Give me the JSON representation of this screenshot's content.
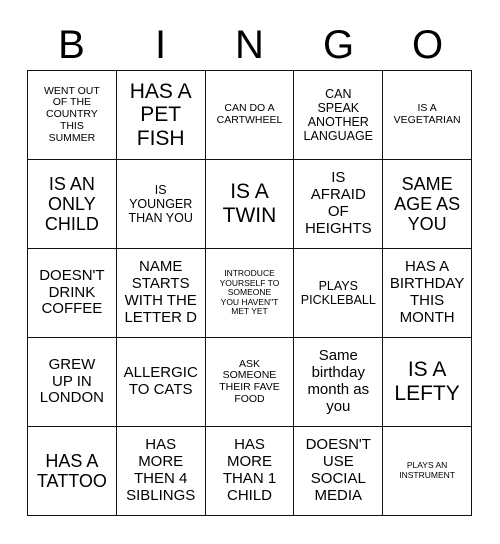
{
  "header": {
    "letters": [
      "B",
      "I",
      "N",
      "G",
      "O"
    ]
  },
  "grid": {
    "rows": 5,
    "columns": 5,
    "cells": [
      {
        "text": "WENT OUT\nOF THE\nCOUNTRY\nTHIS\nSUMMER",
        "size": "xs"
      },
      {
        "text": "HAS A\nPET\nFISH",
        "size": "xl"
      },
      {
        "text": "CAN DO A\nCARTWHEEL",
        "size": "xs"
      },
      {
        "text": "CAN\nSPEAK\nANOTHER\nLANGUAGE",
        "size": "sm"
      },
      {
        "text": "IS A\nVEGETARIAN",
        "size": "xs"
      },
      {
        "text": "IS AN\nONLY\nCHILD",
        "size": "lg"
      },
      {
        "text": "IS\nYOUNGER\nTHAN YOU",
        "size": "sm"
      },
      {
        "text": "IS A\nTWIN",
        "size": "xl"
      },
      {
        "text": "IS\nAFRAID\nOF\nHEIGHTS",
        "size": "md"
      },
      {
        "text": "SAME\nAGE AS\nYOU",
        "size": "lg"
      },
      {
        "text": "DOESN'T\nDRINK\nCOFFEE",
        "size": "md"
      },
      {
        "text": "NAME\nSTARTS\nWITH THE\nLETTER D",
        "size": "md"
      },
      {
        "text": "INTRODUCE\nYOURSELF TO\nSOMEONE\nYOU HAVEN\"T\nMET YET",
        "size": "xxs"
      },
      {
        "text": "PLAYS\nPICKLEBALL",
        "size": "sm"
      },
      {
        "text": "HAS A\nBIRTHDAY\nTHIS\nMONTH",
        "size": "md"
      },
      {
        "text": "GREW\nUP IN\nLONDON",
        "size": "md"
      },
      {
        "text": "ALLERGIC\nTO CATS",
        "size": "md"
      },
      {
        "text": "ASK\nSOMEONE\nTHEIR FAVE\nFOOD",
        "size": "xs"
      },
      {
        "text": "Same\nbirthday\nmonth as\nyou",
        "size": "md"
      },
      {
        "text": "IS A\nLEFTY",
        "size": "xl"
      },
      {
        "text": "HAS A\nTATTOO",
        "size": "lg"
      },
      {
        "text": "HAS\nMORE\nTHEN 4\nSIBLINGS",
        "size": "md"
      },
      {
        "text": "HAS\nMORE\nTHAN 1\nCHILD",
        "size": "md"
      },
      {
        "text": "DOESN'T\nUSE\nSOCIAL\nMEDIA",
        "size": "md"
      },
      {
        "text": "PLAYS AN\nINSTRUMENT",
        "size": "xxs"
      }
    ]
  }
}
